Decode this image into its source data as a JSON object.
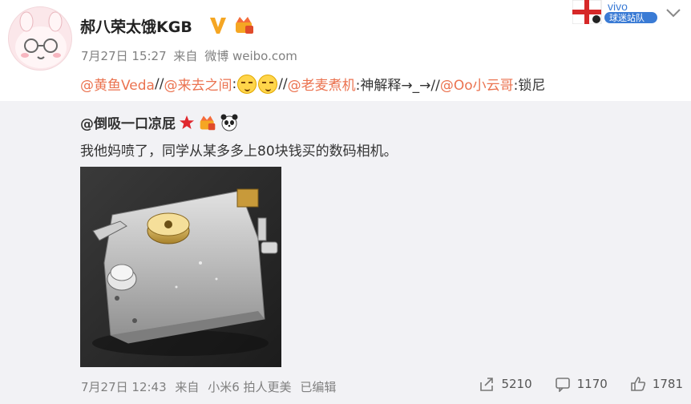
{
  "post": {
    "username": "郝八荣太饿KGB",
    "date": "7月27日 15:27",
    "source_prefix": "来自",
    "source": "微博 weibo.com",
    "repost_chain": [
      {
        "mention": "@黄鱼Veda",
        "sep": " //"
      },
      {
        "mention": "@来去之间",
        "sep": ": "
      },
      {
        "mention": "@老麦煮机",
        "text": ":神解释→_→//"
      },
      {
        "mention": "@Oo小云哥",
        "text": ":锁尼"
      }
    ]
  },
  "sponsor": {
    "brand": "vivo",
    "label": "球迷站队"
  },
  "quoted": {
    "username": "@倒吸一口凉屁",
    "text": "我他妈喷了，同学从某多多上80块钱买的数码相机。",
    "image_subject": "door-lock-photo"
  },
  "footer": {
    "date": "7月27日 12:43",
    "source_prefix": "来自",
    "source": "小米6 拍人更美",
    "edited": "已编辑",
    "reposts": "5210",
    "comments": "1170",
    "likes": "1781"
  },
  "colors": {
    "mention": "#eb7350",
    "meta": "#808080",
    "quote_bg": "#f2f2f5",
    "vip": "#f5a623"
  }
}
